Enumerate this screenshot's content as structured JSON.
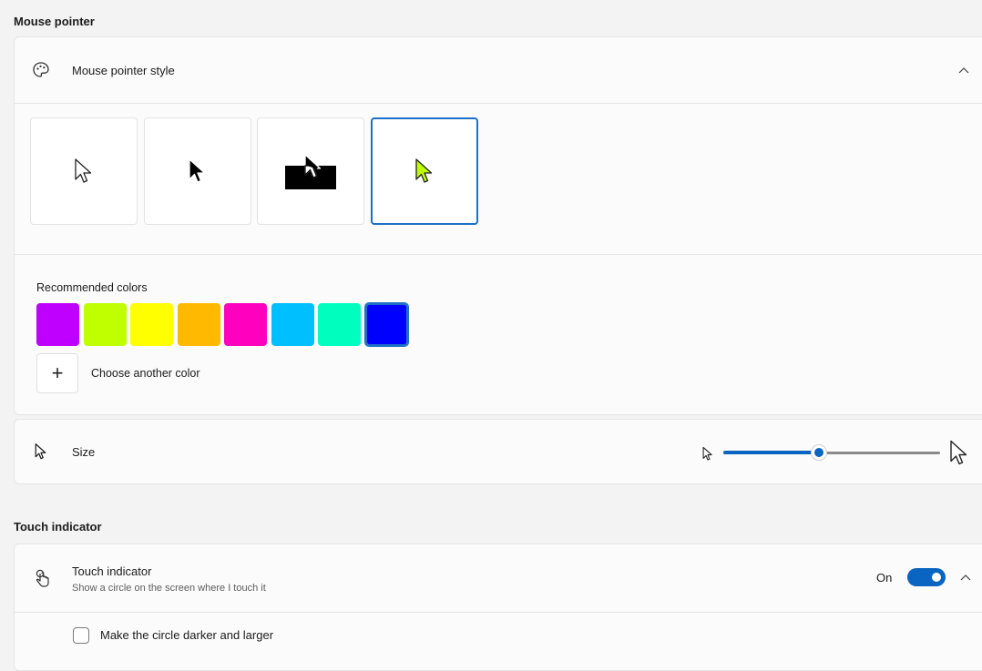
{
  "mouse_pointer": {
    "section_title": "Mouse pointer",
    "style_label": "Mouse pointer style",
    "style_icon": "palette-icon",
    "collapse_icon": "chevron-up-icon",
    "styles": [
      {
        "name": "white",
        "selected": false
      },
      {
        "name": "black",
        "selected": false
      },
      {
        "name": "inverted",
        "selected": false
      },
      {
        "name": "custom",
        "selected": true
      }
    ],
    "recommended_colors_label": "Recommended colors",
    "colors": [
      "#bf00ff",
      "#bfff00",
      "#ffff00",
      "#ffb900",
      "#ff00bf",
      "#00bfff",
      "#00ffbf",
      "#0000ff"
    ],
    "selected_color": "#0000ff",
    "custom_pointer_color": "#bfff00",
    "choose_color_label": "Choose another color",
    "size_label": "Size",
    "size_value": 0.44
  },
  "touch_indicator": {
    "section_title": "Touch indicator",
    "label": "Touch indicator",
    "description": "Show a circle on the screen where I touch it",
    "state_label": "On",
    "enabled": true,
    "darker_label": "Make the circle darker and larger",
    "darker_checked": false
  },
  "colors": {
    "accent": "#1e6fc6"
  }
}
